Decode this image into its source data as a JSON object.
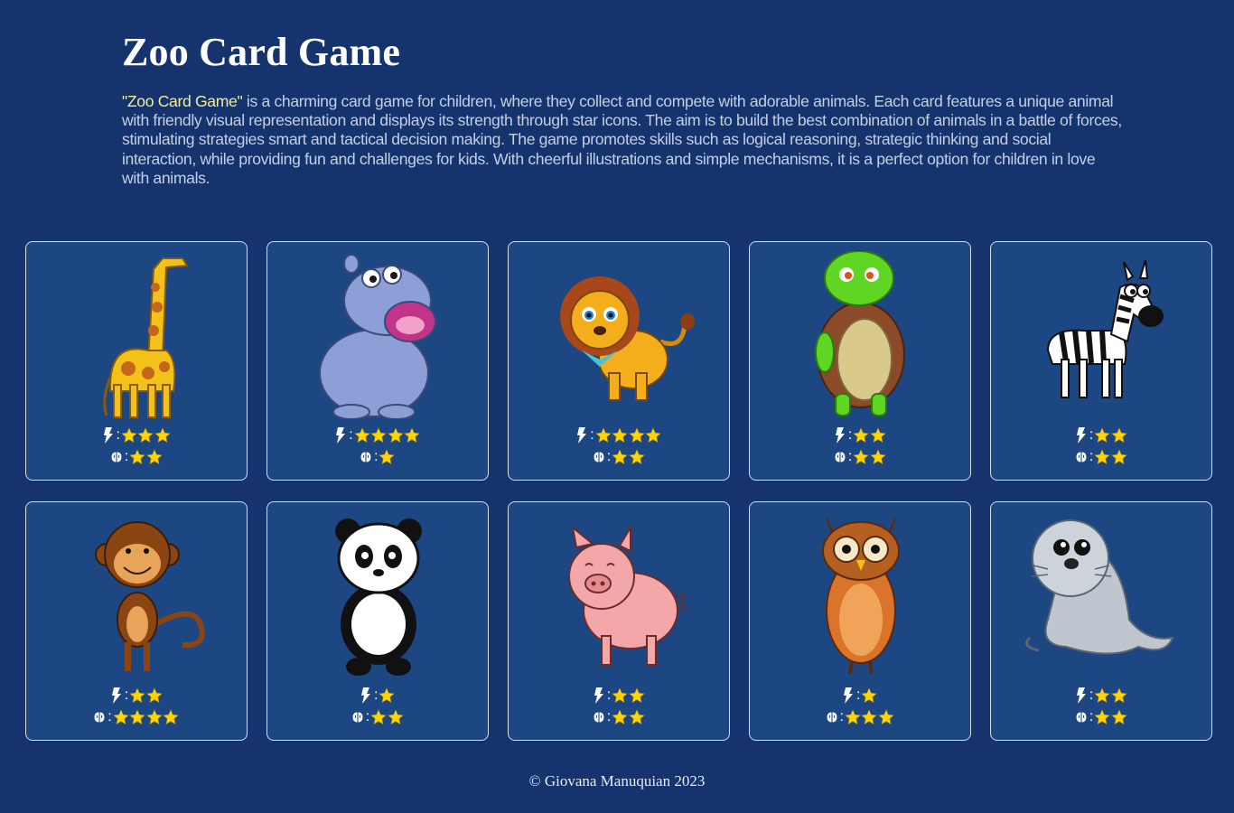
{
  "header": {
    "title": "Zoo Card Game",
    "description_highlight": "\"Zoo Card Game\"",
    "description_rest": " is a charming card game for children, where they collect and compete with adorable animals. Each card features a unique animal with friendly visual representation and displays its strength through star icons. The aim is to build the best combination of animals in a battle of forces, stimulating strategies smart and tactical decision making. The game promotes skills such as logical reasoning, strategic thinking and social interaction, while providing fun and challenges for kids. With cheerful illustrations and simple mechanisms, it is a perfect option for children in love with animals."
  },
  "stat_labels": {
    "separator": ":"
  },
  "icons": {
    "power": "lightning-icon",
    "intelligence": "brain-icon",
    "rating": "star-icon"
  },
  "colors": {
    "background": "#15346e",
    "card": "#1c4783",
    "star": "#ffd400",
    "highlight": "#f3ec9a"
  },
  "cards": [
    {
      "animal": "giraffe",
      "power": 3,
      "intelligence": 2
    },
    {
      "animal": "hippo",
      "power": 4,
      "intelligence": 1
    },
    {
      "animal": "lion",
      "power": 4,
      "intelligence": 2
    },
    {
      "animal": "turtle",
      "power": 2,
      "intelligence": 2
    },
    {
      "animal": "zebra",
      "power": 2,
      "intelligence": 2
    },
    {
      "animal": "monkey",
      "power": 2,
      "intelligence": 4
    },
    {
      "animal": "panda",
      "power": 1,
      "intelligence": 2
    },
    {
      "animal": "pig",
      "power": 2,
      "intelligence": 2
    },
    {
      "animal": "owl",
      "power": 1,
      "intelligence": 3
    },
    {
      "animal": "seal",
      "power": 2,
      "intelligence": 2
    }
  ],
  "footer": {
    "copyright": "© Giovana Manuquian 2023"
  }
}
